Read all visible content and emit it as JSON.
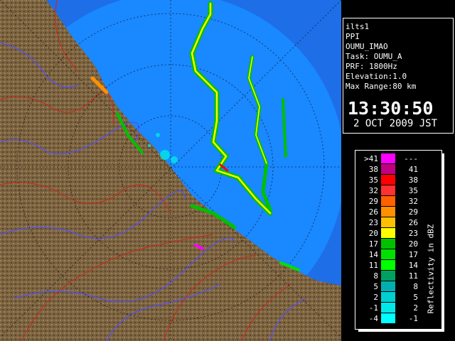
{
  "info": {
    "radar_name": "ilts1",
    "scan_mode": "PPI",
    "site_code": "OUMU_IMAO",
    "task": "Task: OUMU_A",
    "prf": "PRF: 1800Hz",
    "elevation": "Elevation:1.0",
    "max_range": "Max Range:80 km",
    "time": "13:30:50",
    "date": "2 OCT 2009 JST"
  },
  "legend": {
    "title": "Reflectivity in dBZ",
    "rows": [
      {
        "lo": ">41",
        "hi": "---",
        "color": "#ff00ff"
      },
      {
        "lo": "38",
        "hi": "41",
        "color": "#c00080"
      },
      {
        "lo": "35",
        "hi": "38",
        "color": "#ff0000"
      },
      {
        "lo": "32",
        "hi": "35",
        "color": "#ff3030"
      },
      {
        "lo": "29",
        "hi": "32",
        "color": "#ff6000"
      },
      {
        "lo": "26",
        "hi": "29",
        "color": "#ff9000"
      },
      {
        "lo": "23",
        "hi": "26",
        "color": "#ffc000"
      },
      {
        "lo": "20",
        "hi": "23",
        "color": "#ffff00"
      },
      {
        "lo": "17",
        "hi": "20",
        "color": "#00c000"
      },
      {
        "lo": "14",
        "hi": "17",
        "color": "#00e000"
      },
      {
        "lo": "11",
        "hi": "14",
        "color": "#00ff00"
      },
      {
        "lo": "8",
        "hi": "11",
        "color": "#00a060"
      },
      {
        "lo": "5",
        "hi": "8",
        "color": "#00b0b0"
      },
      {
        "lo": "2",
        "hi": "5",
        "color": "#00d0d0"
      },
      {
        "lo": "-1",
        "hi": "2",
        "color": "#00e8e8"
      },
      {
        "lo": "-4",
        "hi": "-1",
        "color": "#00ffff"
      }
    ]
  },
  "colors": {
    "sea": "#1e6ee8",
    "coverage": "#1a88ff",
    "land": "#7a6240",
    "rivers": "#5050ff",
    "borders": "#c03020"
  }
}
